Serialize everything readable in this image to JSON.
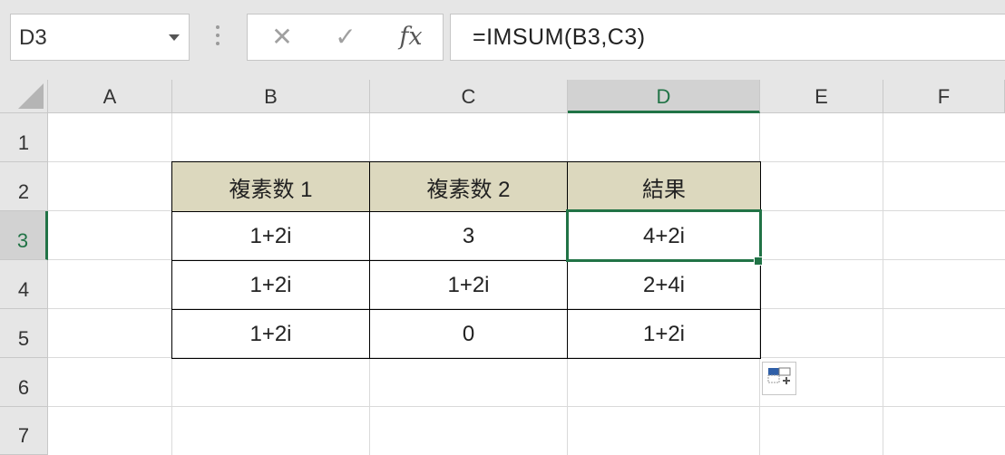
{
  "name_box": {
    "value": "D3"
  },
  "formula_bar": {
    "cancel_symbol": "✕",
    "enter_symbol": "✓",
    "fx_label": "fx",
    "formula": "=IMSUM(B3,C3)"
  },
  "columns": [
    "A",
    "B",
    "C",
    "D",
    "E",
    "F"
  ],
  "rows": [
    "1",
    "2",
    "3",
    "4",
    "5",
    "6",
    "7"
  ],
  "selected": {
    "column": "D",
    "row": "3",
    "accent_color": "#217346"
  },
  "table": {
    "header_fill": "#dcd8be",
    "headers": [
      "複素数 1",
      "複素数 2",
      "結果"
    ],
    "rows": [
      [
        "1+2i",
        "3",
        "4+2i"
      ],
      [
        "1+2i",
        "1+2i",
        "2+4i"
      ],
      [
        "1+2i",
        "0",
        "1+2i"
      ]
    ]
  },
  "quick_analysis": {
    "icon": "quick-analysis-icon"
  }
}
